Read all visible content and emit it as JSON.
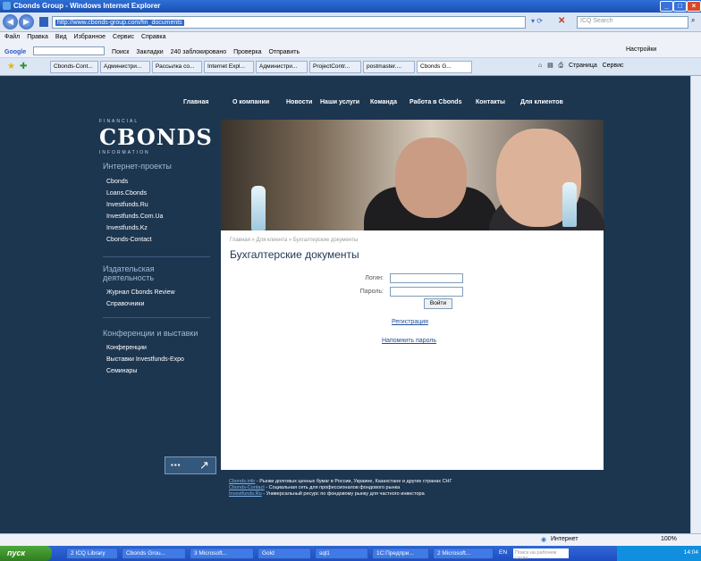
{
  "browser": {
    "title": "Cbonds Group - Windows Internet Explorer",
    "url": "http://www.cbonds-group.com/fin_documents",
    "search_placeholder": "ICQ Search",
    "menu": [
      "Файл",
      "Правка",
      "Вид",
      "Избранное",
      "Сервис",
      "Справка"
    ],
    "google_bar": [
      "Google",
      "Поиск",
      "Закладки",
      "240 заблокировано",
      "Проверка",
      "Отправить"
    ],
    "google_right": "Настройки",
    "tabs": [
      "Cbonds-Cont...",
      "Администри...",
      "Рассылка со...",
      "Internet Expl...",
      "Администри...",
      "ProjectContr...",
      "postmaster....",
      "Cbonds G..."
    ],
    "right_tools": [
      "Страница",
      "Сервис"
    ]
  },
  "site": {
    "nav": [
      "Главная",
      "О компании",
      "Новости",
      "Наши услуги",
      "Команда",
      "Работа в Cbonds",
      "Контакты",
      "Для клиентов"
    ],
    "logo_top": "FINANCIAL",
    "logo": "CBONDS",
    "logo_bottom": "INFORMATION",
    "sidebar": [
      {
        "heading": "Интернет-проекты",
        "links": [
          "Cbonds",
          "Loans.Cbonds",
          "Investfunds.Ru",
          "Investfunds.Com.Ua",
          "Investfunds.Kz",
          "Cbonds-Contact"
        ]
      },
      {
        "heading": "Издательская деятельность",
        "links": [
          "Журнал Cbonds Review",
          "Справочники"
        ]
      },
      {
        "heading": "Конференции и выставки",
        "links": [
          "Конференции",
          "Выставки Investfunds-Expo",
          "Семинары"
        ]
      }
    ],
    "breadcrumb": "Главная » Для клиента » Бухгалтерские документы",
    "page_title": "Бухгалтерские документы",
    "login_label": "Логин:",
    "password_label": "Пароль:",
    "login_button": "Войти",
    "register_link": "Регистрация",
    "remind_link": "Напомнить пароль",
    "footer": [
      {
        "link": "Cbonds.info",
        "text": " - Рынки долговых ценных бумаг в России, Украине, Казахстане и других странах СНГ"
      },
      {
        "link": "Cbonds-Contact",
        "text": " - Социальная сеть для профессионалов фондового рынка"
      },
      {
        "link": "Investfunds.Ru",
        "text": " - Универсальный ресурс по фондовому рынку для частного инвестора"
      }
    ]
  },
  "status": {
    "zone": "Интернет",
    "zoom": "100%"
  },
  "taskbar": {
    "start": "пуск",
    "items": [
      "2 ICQ Library",
      "Cbonds Grou...",
      "3 Microsoft...",
      "Gold",
      "sql1",
      "1С:Предпри...",
      "2 Microsoft..."
    ],
    "lang": "EN",
    "tray_search": "Поиск на рабочем столе",
    "clock": "14:04"
  }
}
